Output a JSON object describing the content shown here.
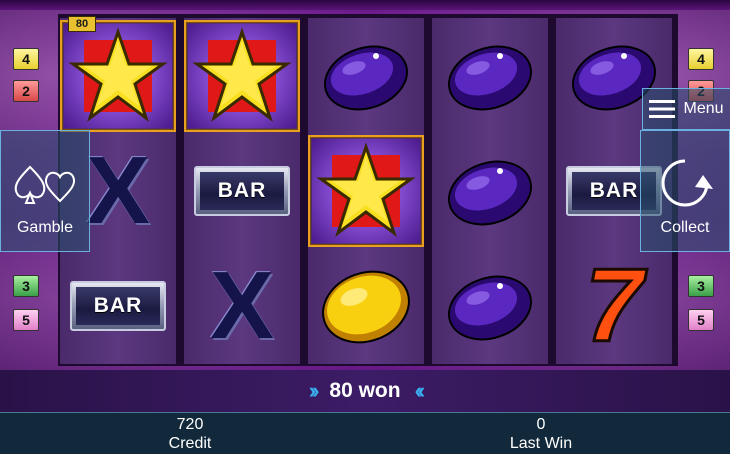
{
  "win_badge": "80",
  "paylines_left": [
    "4",
    "2",
    "3",
    "5"
  ],
  "paylines_right": [
    "4",
    "2",
    "3",
    "5"
  ],
  "reels": [
    [
      "star",
      "x",
      "bar"
    ],
    [
      "star",
      "bar",
      "x"
    ],
    [
      "plum",
      "star",
      "lemon"
    ],
    [
      "plum",
      "plum",
      "plum"
    ],
    [
      "plum",
      "bar",
      "seven"
    ]
  ],
  "symbols": {
    "bar_label": "BAR",
    "x_label": "X",
    "seven_label": "7"
  },
  "buttons": {
    "gamble_label": "Gamble",
    "collect_label": "Collect",
    "menu_label": "Menu"
  },
  "win_message": "80 won",
  "credit": {
    "value": "720",
    "label": "Credit"
  },
  "last_win": {
    "value": "0",
    "label": "Last Win"
  },
  "colors": {
    "accent": "#3ab0f0",
    "win_frame": "#e8a020",
    "star_red": "#e01818"
  }
}
